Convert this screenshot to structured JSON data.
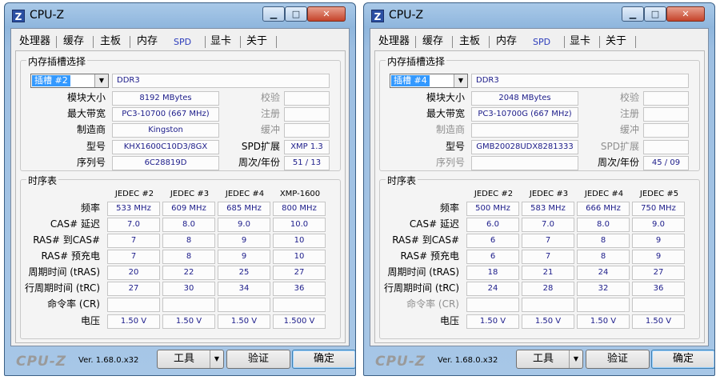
{
  "windows": [
    {
      "title": "CPU-Z",
      "tabs": [
        "处理器",
        "缓存",
        "主板",
        "内存",
        "SPD",
        "显卡",
        "关于"
      ],
      "active_tab": "SPD",
      "slot_group_label": "内存插槽选择",
      "slot_selected": "插槽 #2",
      "memory_type": "DDR3",
      "info": {
        "module_size_label": "模块大小",
        "module_size": "8192 MBytes",
        "max_bandwidth_label": "最大带宽",
        "max_bandwidth": "PC3-10700 (667 MHz)",
        "manufacturer_label": "制造商",
        "manufacturer": "Kingston",
        "part_label": "型号",
        "part": "KHX1600C10D3/8GX",
        "serial_label": "序列号",
        "serial": "6C28819D",
        "correction_label": "校验",
        "correction": "",
        "registered_label": "注册",
        "registered": "",
        "buffered_label": "缓冲",
        "buffered": "",
        "spd_ext_label": "SPD扩展",
        "spd_ext": "XMP 1.3",
        "week_year_label": "周次/年份",
        "week_year": "51 / 13"
      },
      "timing_group_label": "时序表",
      "timing_columns": [
        "JEDEC #2",
        "JEDEC #3",
        "JEDEC #4",
        "XMP-1600"
      ],
      "timing_rows": [
        {
          "label": "频率",
          "values": [
            "533 MHz",
            "609 MHz",
            "685 MHz",
            "800 MHz"
          ]
        },
        {
          "label": "CAS# 延迟",
          "values": [
            "7.0",
            "8.0",
            "9.0",
            "10.0"
          ]
        },
        {
          "label": "RAS# 到CAS#",
          "values": [
            "7",
            "8",
            "9",
            "10"
          ]
        },
        {
          "label": "RAS# 预充电",
          "values": [
            "7",
            "8",
            "9",
            "10"
          ]
        },
        {
          "label": "周期时间 (tRAS)",
          "values": [
            "20",
            "22",
            "25",
            "27"
          ]
        },
        {
          "label": "行周期时间 (tRC)",
          "values": [
            "27",
            "30",
            "34",
            "36"
          ]
        },
        {
          "label": "命令率 (CR)",
          "values": [
            "",
            "",
            "",
            ""
          ]
        },
        {
          "label": "电压",
          "values": [
            "1.50 V",
            "1.50 V",
            "1.50 V",
            "1.500 V"
          ]
        }
      ],
      "footer": {
        "brand": "CPU-Z",
        "version": "Ver. 1.68.0.x32",
        "tools": "工具",
        "verify": "验证",
        "ok": "确定"
      }
    },
    {
      "title": "CPU-Z",
      "tabs": [
        "处理器",
        "缓存",
        "主板",
        "内存",
        "SPD",
        "显卡",
        "关于"
      ],
      "active_tab": "SPD",
      "slot_group_label": "内存插槽选择",
      "slot_selected": "插槽 #4",
      "memory_type": "DDR3",
      "info": {
        "module_size_label": "模块大小",
        "module_size": "2048 MBytes",
        "max_bandwidth_label": "最大带宽",
        "max_bandwidth": "PC3-10700G (667 MHz)",
        "manufacturer_label": "制造商",
        "manufacturer": "",
        "part_label": "型号",
        "part": "GMB20028UDX8281333",
        "serial_label": "序列号",
        "serial": "",
        "correction_label": "校验",
        "correction": "",
        "registered_label": "注册",
        "registered": "",
        "buffered_label": "缓冲",
        "buffered": "",
        "spd_ext_label": "SPD扩展",
        "spd_ext": "",
        "week_year_label": "周次/年份",
        "week_year": "45 / 09"
      },
      "timing_group_label": "时序表",
      "timing_columns": [
        "JEDEC #2",
        "JEDEC #3",
        "JEDEC #4",
        "JEDEC #5"
      ],
      "timing_rows": [
        {
          "label": "频率",
          "values": [
            "500 MHz",
            "583 MHz",
            "666 MHz",
            "750 MHz"
          ]
        },
        {
          "label": "CAS# 延迟",
          "values": [
            "6.0",
            "7.0",
            "8.0",
            "9.0"
          ]
        },
        {
          "label": "RAS# 到CAS#",
          "values": [
            "6",
            "7",
            "8",
            "9"
          ]
        },
        {
          "label": "RAS# 预充电",
          "values": [
            "6",
            "7",
            "8",
            "9"
          ]
        },
        {
          "label": "周期时间 (tRAS)",
          "values": [
            "18",
            "21",
            "24",
            "27"
          ]
        },
        {
          "label": "行周期时间 (tRC)",
          "values": [
            "24",
            "28",
            "32",
            "36"
          ]
        },
        {
          "label": "命令率 (CR)",
          "values": [
            "",
            "",
            "",
            ""
          ]
        },
        {
          "label": "电压",
          "values": [
            "1.50 V",
            "1.50 V",
            "1.50 V",
            "1.50 V"
          ]
        }
      ],
      "footer": {
        "brand": "CPU-Z",
        "version": "Ver. 1.68.0.x32",
        "tools": "工具",
        "verify": "验证",
        "ok": "确定"
      }
    }
  ]
}
